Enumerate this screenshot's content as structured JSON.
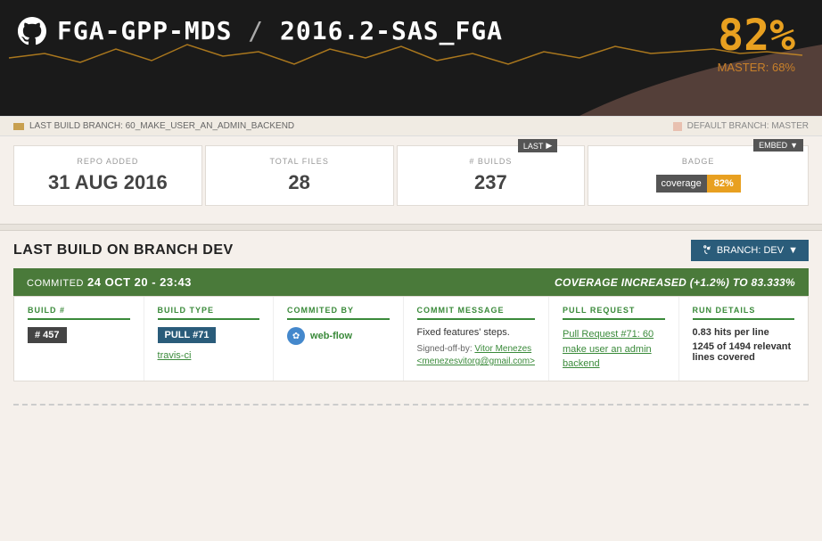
{
  "header": {
    "repo_owner": "FGA-GPP-MDS",
    "slash": "/",
    "repo_name": "2016.2-SAS_FGA",
    "coverage_percent": "82%",
    "master_label": "MASTER: 68%"
  },
  "branch_bar": {
    "last_build_label": "LAST BUILD BRANCH: 60_MAKE_USER_AN_ADMIN_BACKEND",
    "default_branch_label": "DEFAULT BRANCH: MASTER"
  },
  "stats": {
    "repo_added_label": "REPO ADDED",
    "repo_added_value": "31 AUG 2016",
    "total_files_label": "TOTAL FILES",
    "total_files_value": "28",
    "builds_label": "# BUILDS",
    "builds_value": "237",
    "badge_label": "BADGE",
    "badge_coverage_text": "coverage",
    "badge_coverage_value": "82%",
    "last_button": "LAST",
    "embed_button": "EMBED"
  },
  "last_build": {
    "section_title": "LAST BUILD ON BRANCH DEV",
    "branch_button": "BRANCH: DEV",
    "commit_label": "COMMITED",
    "commit_datetime": "24 OCT 20 - 23:43",
    "coverage_change": "COVERAGE INCREASED (+1.2%) TO 83.333%",
    "build_number_label": "BUILD #",
    "build_number_value": "# 457",
    "build_type_label": "BUILD TYPE",
    "build_type_value": "PULL #71",
    "committed_by_label": "COMMITED BY",
    "committer_name": "web-flow",
    "travis_ci": "travis-ci",
    "commit_message_label": "COMMIT MESSAGE",
    "commit_message": "Fixed features' steps.",
    "signed_off_text": "Signed-off-by: Vitor Menezes <menezesvitorg@gmail.com>",
    "pull_request_label": "PULL REQUEST",
    "pull_request_text": "Pull Request #71: 60 make user an admin backend",
    "run_details_label": "RUN DETAILS",
    "hits_per_line": "0.83 hits per line",
    "lines_covered": "1245 of 1494 relevant lines covered"
  }
}
